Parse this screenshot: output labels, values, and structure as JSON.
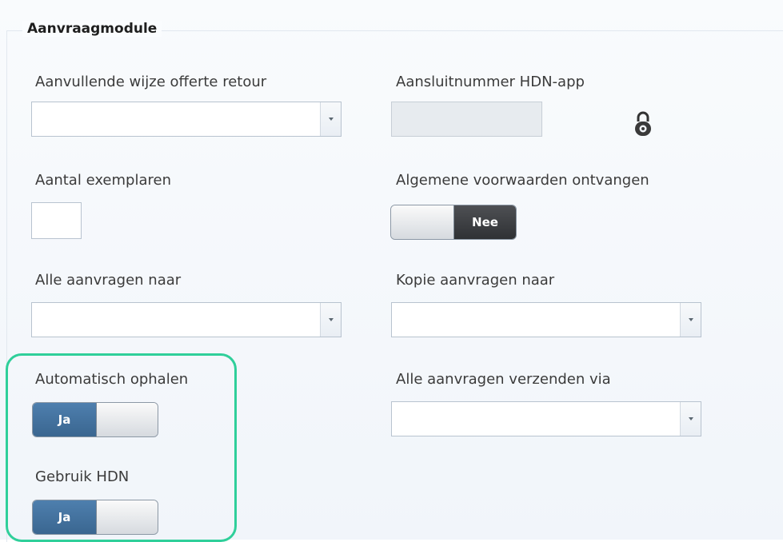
{
  "group": {
    "title": "Aanvraagmodule"
  },
  "fields": {
    "offerte_retour": {
      "label": "Aanvullende wijze offerte retour",
      "value": ""
    },
    "aansluitnummer": {
      "label": "Aansluitnummer HDN-app",
      "value": "",
      "locked_icon": "lock-icon"
    },
    "aantal_exemplaren": {
      "label": "Aantal exemplaren",
      "value": ""
    },
    "algemene_voorwaarden": {
      "label": "Algemene voorwaarden ontvangen",
      "toggle_text": "Nee",
      "state": "off"
    },
    "alle_aanvragen_naar": {
      "label": "Alle aanvragen naar",
      "value": ""
    },
    "kopie_aanvragen_naar": {
      "label": "Kopie aanvragen naar",
      "value": ""
    },
    "automatisch_ophalen": {
      "label": "Automatisch ophalen",
      "toggle_text": "Ja",
      "state": "on"
    },
    "verzenden_via": {
      "label": "Alle aanvragen verzenden via",
      "value": ""
    },
    "gebruik_hdn": {
      "label": "Gebruik HDN",
      "toggle_text": "Ja",
      "state": "on"
    }
  },
  "colors": {
    "accent": "#3a6690",
    "highlight": "#2fcf9a",
    "toggle_off": "#2f3134"
  }
}
